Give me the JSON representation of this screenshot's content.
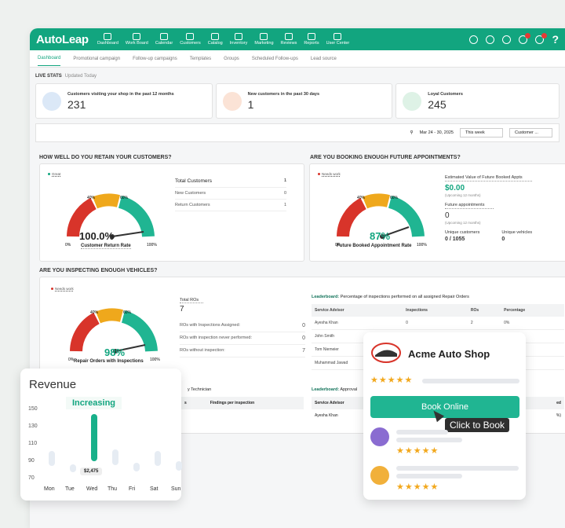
{
  "app": {
    "logo": "AutoLeap",
    "nav": [
      "Dashboard",
      "Work Board",
      "Calendar",
      "Customers",
      "Catalog",
      "Inventory",
      "Marketing",
      "Reviews",
      "Reports",
      "User Center"
    ]
  },
  "tabs": [
    "Dashboard",
    "Promotional campaign",
    "Follow-up campaigns",
    "Templates",
    "Groups",
    "Scheduled Follow-ups",
    "Lead source"
  ],
  "live": {
    "title": "LIVE STATS",
    "sub": "Updated Today"
  },
  "stats": [
    {
      "label": "Customers visiting your shop in the past 12 months",
      "value": "231",
      "color": "#dbe8f7"
    },
    {
      "label": "New customers in the past 30 days",
      "value": "1",
      "color": "#fbe3d6"
    },
    {
      "label": "Loyal Customers",
      "value": "245",
      "color": "#def2e6"
    }
  ],
  "filter": {
    "date": "Mar 24 - 30, 2025",
    "range": "This week",
    "customer": "Customer ..."
  },
  "retain": {
    "title": "HOW WELL DO YOU RETAIN YOUR CUSTOMERS?",
    "badge": "Great",
    "pct": "100.0%",
    "caption": "Customer Return Rate",
    "ticks": [
      "0%",
      "40%",
      "60%",
      "100%"
    ],
    "rows": [
      {
        "k": "Total Customers",
        "v": "1"
      },
      {
        "k": "New Customers",
        "v": "0"
      },
      {
        "k": "Return Customers",
        "v": "1"
      }
    ]
  },
  "booking": {
    "title": "ARE YOU BOOKING ENOUGH FUTURE APPOINTMENTS?",
    "badge": "Needs work",
    "pct": "87%",
    "caption": "Future Booked Appointment Rate",
    "ticks": [
      "0%",
      "40%",
      "60%",
      "100%"
    ],
    "est_label": "Estimated Value of Future Booked Appts",
    "est_value": "$0.00",
    "est_sub": "(Upcoming 12 months)",
    "fa_label": "Future appointments",
    "fa_value": "0",
    "fa_sub": "(Upcoming 12 months)",
    "uc_label": "Unique customers",
    "uc_value": "0 / 1055",
    "uv_label": "Unique vehicles",
    "uv_value": "0"
  },
  "inspect": {
    "title": "ARE YOU INSPECTING ENOUGH VEHICLES?",
    "badge": "Needs work",
    "pct": "98%",
    "caption": "Repair Orders with Inspections",
    "ticks": [
      "0%",
      "40%",
      "60%",
      "100%"
    ],
    "total_label": "Total ROs",
    "total_value": "7",
    "rows": [
      {
        "k": "ROs with Inspections Assigned:",
        "v": "0"
      },
      {
        "k": "ROs with inspection never performed:",
        "v": "0"
      },
      {
        "k": "ROs without inspection:",
        "v": "7"
      }
    ],
    "lb_title": "Leaderboard:",
    "lb_sub": "Percentage of inspections performed on all assigned Repair Orders",
    "headers": [
      "Service Advisor",
      "Inspections",
      "ROs",
      "Percentage"
    ],
    "table": [
      [
        "Ayesha Khan",
        "0",
        "2",
        "0%"
      ],
      [
        "John Smith",
        "",
        "",
        ""
      ],
      [
        "Tom Niemeier",
        "",
        "",
        ""
      ],
      [
        "Muhammad Jawad",
        "",
        "",
        ""
      ]
    ],
    "lb2_left": "y Technician",
    "lb2_cols": [
      "s",
      "Findings per inspection"
    ],
    "lb2_title": "Leaderboard:",
    "lb2_sub": "Approval",
    "lb2_headers": [
      "Service Advisor",
      "ed"
    ],
    "lb2_row": [
      "Ayesha Khan",
      "%)"
    ]
  },
  "revenue": {
    "title": "Revenue",
    "trend": "Increasing",
    "tooltip": "$2,475",
    "chart_data": {
      "type": "bar",
      "title": "Revenue",
      "categories": [
        "Mon",
        "Tue",
        "Wed",
        "Thu",
        "Fri",
        "Sat",
        "Sun"
      ],
      "values": [
        102,
        86,
        145,
        104,
        88,
        102,
        90
      ],
      "highlight": "Wed",
      "ylim": [
        70,
        150
      ],
      "yticks": [
        150,
        130,
        110,
        90,
        70
      ]
    }
  },
  "shop": {
    "name": "Acme Auto Shop",
    "stars": "★★★★★",
    "button": "Book Online",
    "tooltip": "Click to Book"
  }
}
